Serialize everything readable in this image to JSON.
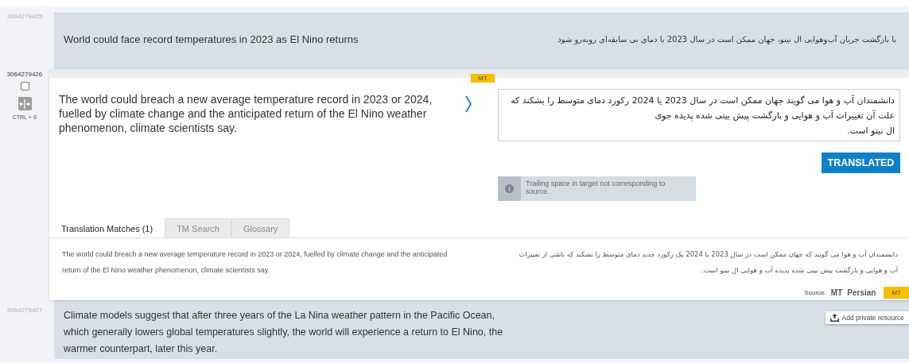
{
  "segments": [
    {
      "kind": "done",
      "id": "3064279425",
      "source": "World could face record temperatures in 2023 as El Nino returns",
      "target": "با بازگشت جریان آب‌وهوایی ال نینو، جهان ممکن است در سال 2023 با دمای بی سابقه‌ای روبه‌رو شود"
    },
    {
      "kind": "active",
      "id": "3064279426",
      "checked": false,
      "shortcut": "CTRL + S",
      "badge": "MT",
      "source": "The world could breach a new average temperature record in 2023 or 2024, fuelled by climate change and the anticipated return of the El Nino weather phenomenon, climate scientists say.",
      "target": "دانشمندان آب و هوا می گویند جهان ممکن است در سال 2023 یا 2024 رکورد دمای متوسط را بشکند که علت آن تغییرات آب و هوایی و بازگشت پیش بینی شده پدیده جوی\nال نینو است.",
      "status_button": "TRANSLATED",
      "warning": "Trailing space in target not corresponding to source.",
      "tabs": [
        {
          "label": "Translation Matches (1)",
          "selected": true
        },
        {
          "label": "TM Search",
          "selected": false
        },
        {
          "label": "Glossary",
          "selected": false
        }
      ],
      "match": {
        "source": "The world could breach a new average temperature record in 2023 or 2024, fuelled by climate change and the anticipated return of the El Nino weather phenomenon, climate scientists say.",
        "target": "دانشمندان آب و هوا می گویند که جهان ممکن است در سال 2023 یا 2024 یک رکورد جدید دمای متوسط را بشکند که ناشی از تغییرات آب و هوایی و بازگشت پیش بینی شده پدیده آب و هوایی ال نینو است.",
        "source_label": "Source:",
        "origin": "MT",
        "language": "Persian",
        "badge": "MT"
      },
      "tooltip": "Add private resource"
    },
    {
      "kind": "done",
      "id": "3064279427",
      "source": "Climate models suggest that after three years of the La Nina weather pattern in the Pacific Ocean, which generally lowers global temperatures slightly, the world will experience a return to El Nino, the warmer counterpart, later this year."
    }
  ]
}
